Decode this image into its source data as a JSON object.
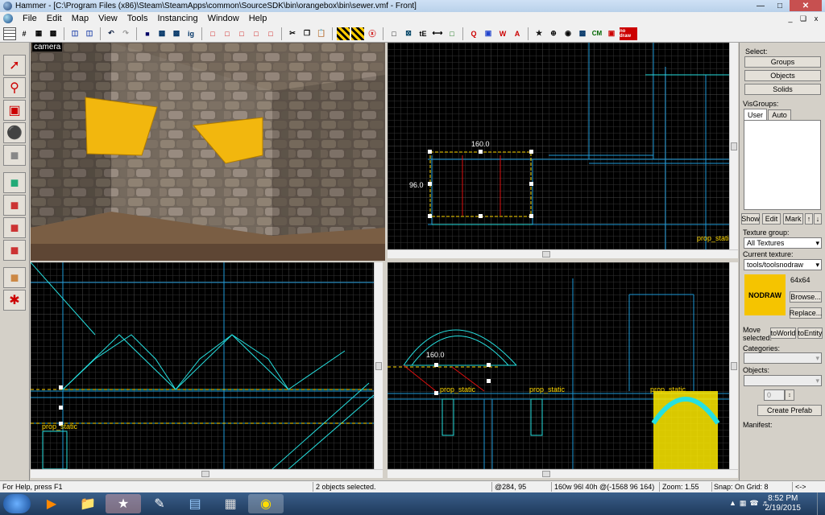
{
  "window": {
    "title": "Hammer - [C:\\Program Files (x86)\\Steam\\SteamApps\\common\\SourceSDK\\bin\\orangebox\\bin\\sewer.vmf - Front]"
  },
  "menu": [
    "File",
    "Edit",
    "Map",
    "View",
    "Tools",
    "Instancing",
    "Window",
    "Help"
  ],
  "toolbar": {
    "cm_label": "CM",
    "nodraw_label": "no draw"
  },
  "viewports": {
    "camera_label": "camera",
    "top_right": {
      "dim_width": "160.0",
      "dim_height": "96.0",
      "entity_label": "prop_static"
    },
    "bottom_left": {
      "entity_label": "prop_static"
    },
    "bottom_right": {
      "dim_width": "160.0",
      "entity_labels": [
        "prop_static",
        "prop_static",
        "prop_static"
      ]
    }
  },
  "right_panel": {
    "select_label": "Select:",
    "select_buttons": [
      "Groups",
      "Objects",
      "Solids"
    ],
    "visgroups_label": "VisGroups:",
    "visgroup_tabs": [
      "User",
      "Auto"
    ],
    "visgroup_buttons": [
      "Show",
      "Edit",
      "Mark"
    ],
    "texture_group_label": "Texture group:",
    "texture_group_value": "All Textures",
    "current_texture_label": "Current texture:",
    "current_texture_value": "tools/toolsnodraw",
    "texture_preview_text": "NODRAW",
    "texture_size": "64x64",
    "browse_button": "Browse...",
    "replace_button": "Replace...",
    "move_selected_label": "Move selected:",
    "to_world_button": "toWorld",
    "to_entity_button": "toEntity",
    "categories_label": "Categories:",
    "objects_label": "Objects:",
    "stepper_value": "0",
    "create_prefab_button": "Create Prefab",
    "manifest_label": "Manifest:"
  },
  "status": {
    "help": "For Help, press F1",
    "selection": "2 objects selected.",
    "coords": "@284, 95",
    "size": "160w 96l 40h @(-1568 96 164)",
    "zoom": "Zoom: 1.55",
    "snap": "Snap: On Grid: 8",
    "nav": "<->"
  },
  "clock": {
    "time": "8:52 PM",
    "date": "2/19/2015"
  },
  "colors": {
    "wireframe_cyan": "#26e0e0",
    "grid": "#3a3a3a",
    "selection_yellow": "#ffd800",
    "selection_red": "#e01010",
    "nodraw_yellow": "#f5c400"
  }
}
